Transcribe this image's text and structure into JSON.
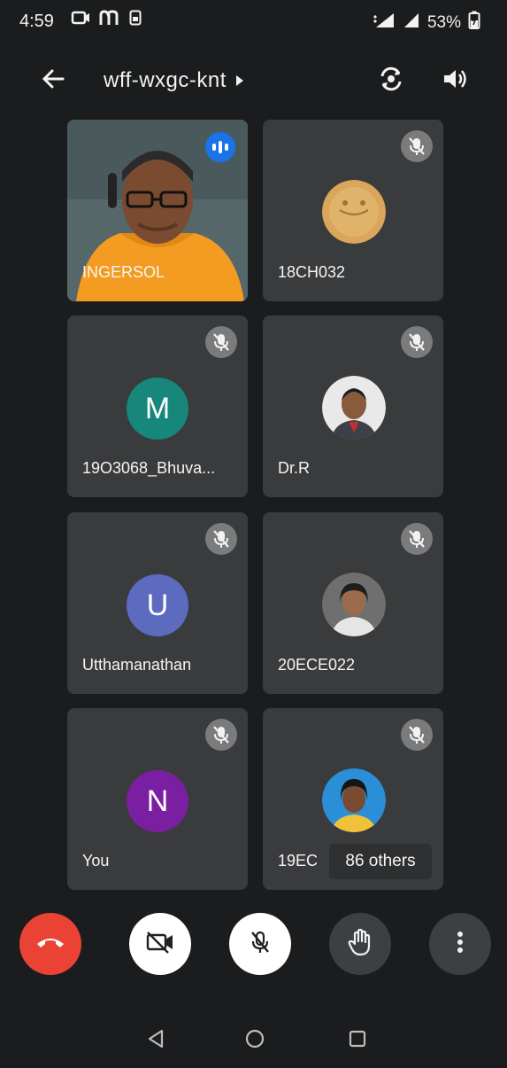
{
  "status_bar": {
    "time": "4:59",
    "battery": "53%",
    "icons": [
      "screen-cast-icon",
      "m-app-icon",
      "sim-icon",
      "volte-icon",
      "signal-icon",
      "battery-icon"
    ]
  },
  "header": {
    "meeting_code": "wff-wxgc-knt",
    "icons": [
      "back-arrow-icon",
      "chevron-right-icon",
      "switch-camera-icon",
      "speaker-icon"
    ]
  },
  "tiles": [
    {
      "name": "INGERSOL",
      "state": "speaking"
    },
    {
      "name": "18CH032",
      "state": "muted"
    },
    {
      "name": "19O3068_Bhuva...",
      "state": "muted",
      "initial": "M",
      "color": "#16877a"
    },
    {
      "name": "Dr.R",
      "state": "muted"
    },
    {
      "name": "Utthamanathan",
      "state": "muted",
      "initial": "U",
      "color": "#5c6bc0"
    },
    {
      "name": "20ECE022",
      "state": "muted"
    },
    {
      "name": "You",
      "state": "muted",
      "initial": "N",
      "color": "#7b1fa2"
    },
    {
      "name": "19EC",
      "state": "muted"
    }
  ],
  "others_chip": "86 others",
  "controls": {
    "end_call_color": "#ea4335",
    "icons": [
      "end-call-icon",
      "camera-off-icon",
      "mic-off-icon",
      "raise-hand-icon",
      "more-options-icon"
    ]
  },
  "nav_bar": {
    "icons": [
      "nav-back-icon",
      "nav-home-icon",
      "nav-recents-icon"
    ]
  }
}
